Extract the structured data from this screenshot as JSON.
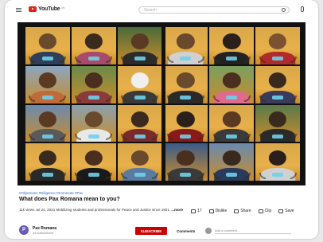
{
  "header": {
    "logo_text": "YouTube",
    "logo_sup": "PK",
    "search_placeholder": "Search",
    "icons": [
      "menu-icon",
      "search-icon",
      "mic-icon"
    ]
  },
  "video": {
    "hashtags": "#Objectives #Diligence #Kommute #Pax",
    "title": "What does Pax Romana mean to you?",
    "meta_prefix": "11k views  Jul 24, 2021",
    "meta_desc": "Mobilizing students and professionals for Peace and Justice since 1921.",
    "more_label": "...more",
    "likes": "17",
    "dislike_label": "Dislike",
    "share_label": "Share",
    "clip_label": "Clip",
    "save_label": "Save"
  },
  "channel": {
    "avatar_letter": "P",
    "name": "Pax Romana",
    "subscribers": "43 subscribers",
    "subscribe_label": "SUBSCRIBE"
  },
  "comments": {
    "label": "Comments",
    "input_placeholder": "Add a comment..."
  },
  "palette": {
    "accent_orange": "#e8b04a",
    "badge_blue": "#6fd0ea",
    "subscribe_red": "#cc0000"
  }
}
